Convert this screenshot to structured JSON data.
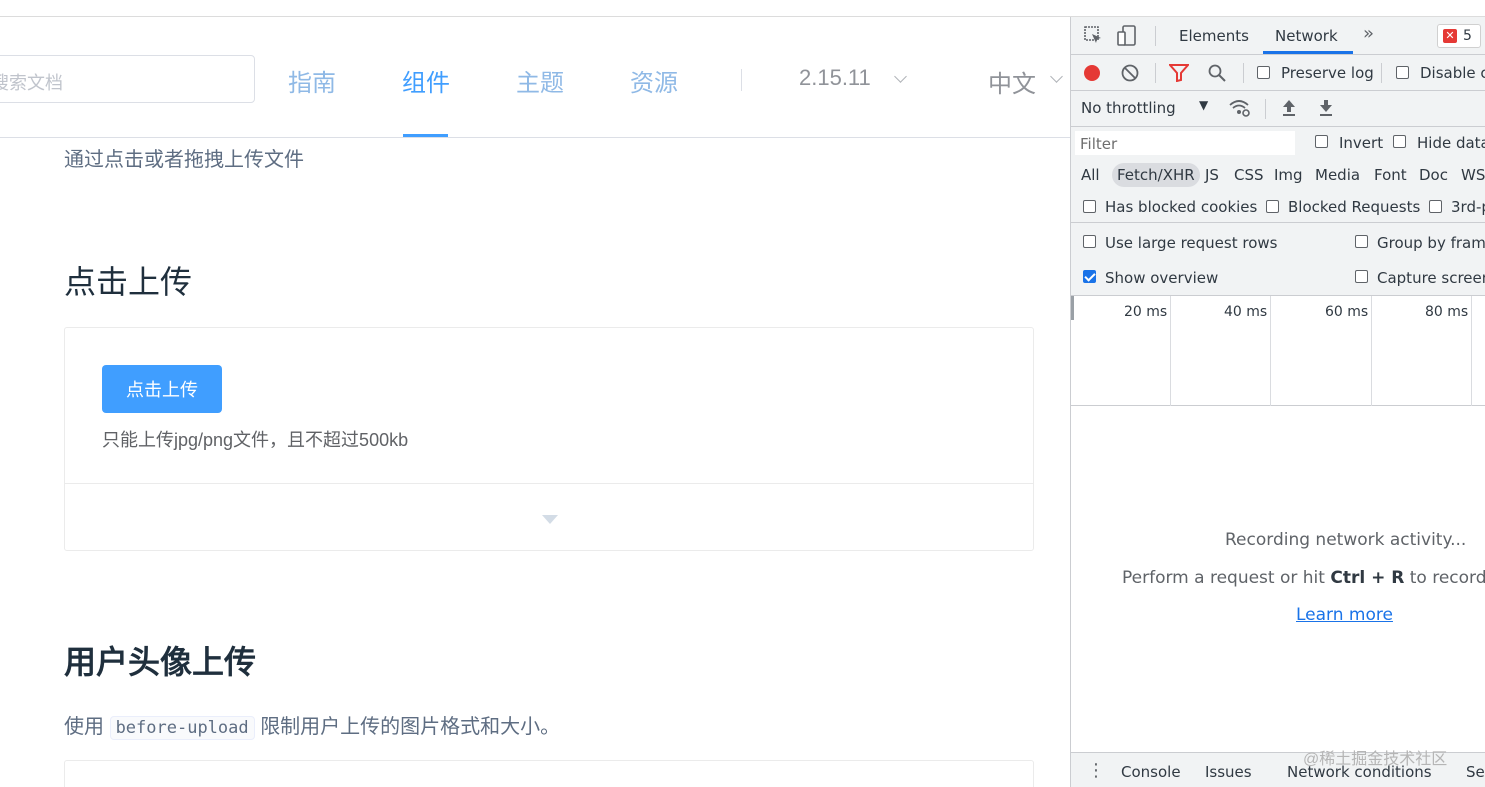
{
  "header": {
    "search_placeholder": "搜索文档",
    "nav": [
      "指南",
      "组件",
      "主题",
      "资源"
    ],
    "version": "2.15.11",
    "language": "中文"
  },
  "content": {
    "intro": "通过点击或者拖拽上传文件",
    "section1_title": "点击上传",
    "upload_button": "点击上传",
    "upload_tip": "只能上传jpg/png文件，且不超过500kb",
    "section2_title": "用户头像上传",
    "section2_desc_before": "使用",
    "section2_code": "before-upload",
    "section2_desc_after": "限制用户上传的图片格式和大小。"
  },
  "devtools": {
    "tabs": [
      "Elements",
      "Network"
    ],
    "error_count": "5",
    "preserve_log": "Preserve log",
    "disable_cache": "Disable ca",
    "throttling": "No throttling",
    "filter_placeholder": "Filter",
    "invert": "Invert",
    "hide_data": "Hide data",
    "types": [
      "All",
      "Fetch/XHR",
      "JS",
      "CSS",
      "Img",
      "Media",
      "Font",
      "Doc",
      "WS"
    ],
    "has_blocked_cookies": "Has blocked cookies",
    "blocked_requests": "Blocked Requests",
    "third_party": "3rd-p",
    "large_rows": "Use large request rows",
    "group_by_frame": "Group by frame",
    "show_overview": "Show overview",
    "capture_screenshots": "Capture screen",
    "timeline_labels": [
      "20 ms",
      "40 ms",
      "60 ms",
      "80 ms"
    ],
    "recording": "Recording network activity...",
    "perform_before": "Perform a request or hit ",
    "perform_key": "Ctrl + R",
    "perform_after": " to record th",
    "learn_more": "Learn more",
    "drawer_tabs": [
      "Console",
      "Issues",
      "Network conditions",
      "Sea"
    ]
  },
  "watermark": "@稀土掘金技术社区"
}
